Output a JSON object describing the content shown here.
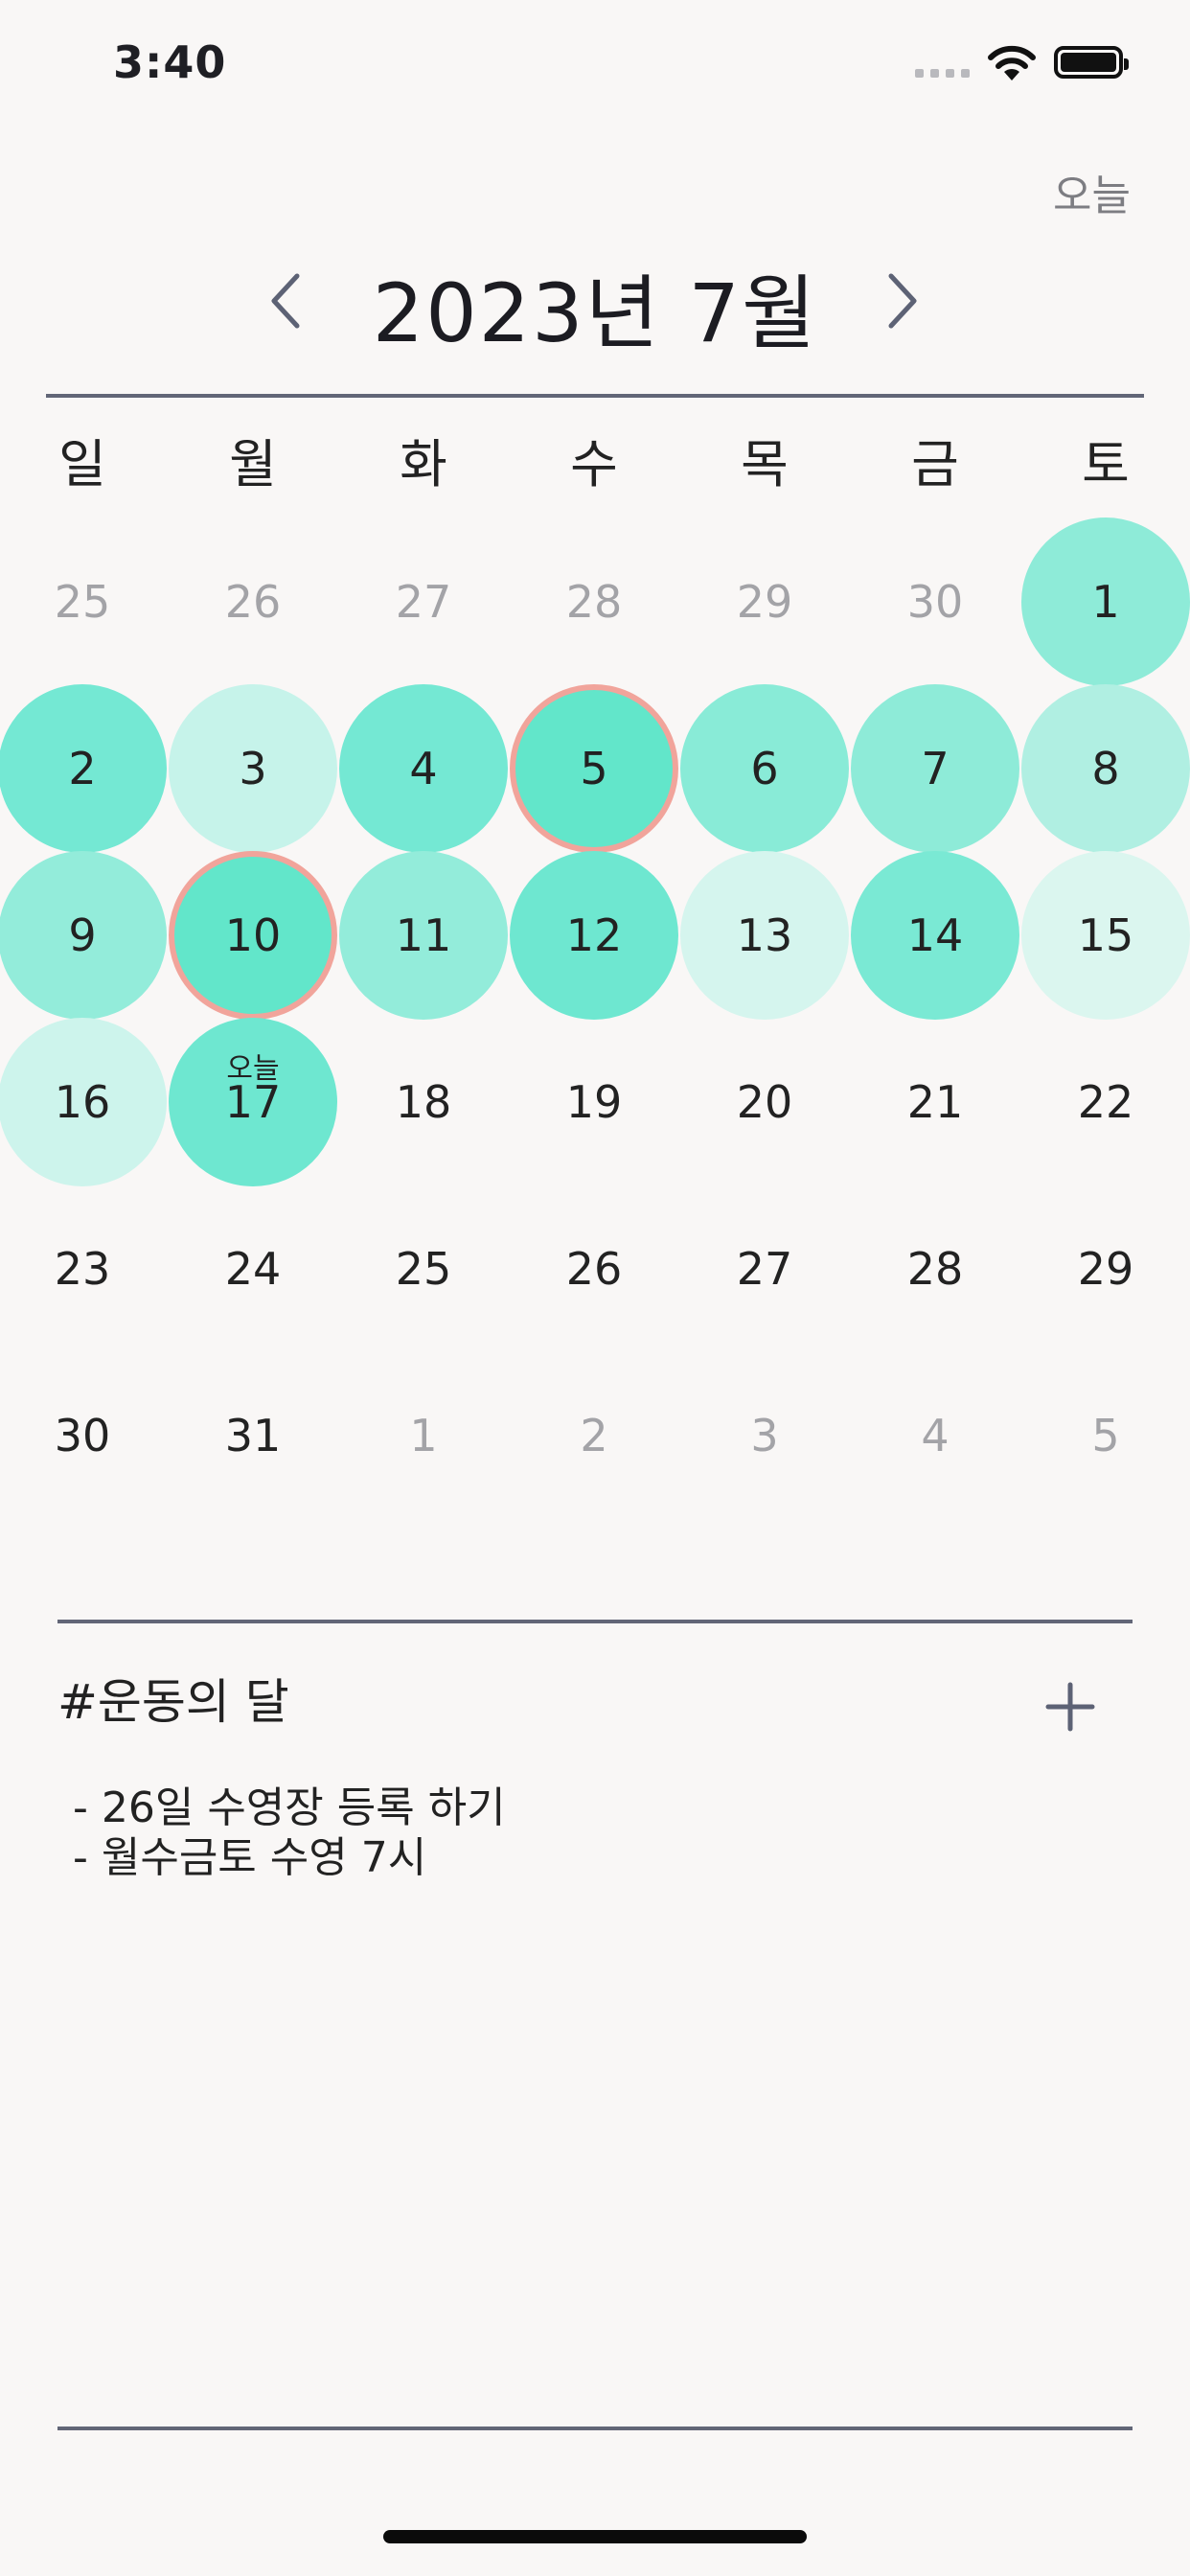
{
  "status_bar": {
    "time": "3:40"
  },
  "header": {
    "today_button": "오늘",
    "month_title": "2023년 7월"
  },
  "weekdays": [
    "일",
    "월",
    "화",
    "수",
    "목",
    "금",
    "토"
  ],
  "calendar": {
    "today_tag": "오늘",
    "weeks": [
      [
        {
          "d": "25",
          "other": true
        },
        {
          "d": "26",
          "other": true
        },
        {
          "d": "27",
          "other": true
        },
        {
          "d": "28",
          "other": true
        },
        {
          "d": "29",
          "other": true
        },
        {
          "d": "30",
          "other": true
        },
        {
          "d": "1",
          "color": "#8eebd8"
        }
      ],
      [
        {
          "d": "2",
          "color": "#74e8d3"
        },
        {
          "d": "3",
          "color": "#c6f3ea"
        },
        {
          "d": "4",
          "color": "#74e8d3"
        },
        {
          "d": "5",
          "color": "#62e6ca",
          "ring": true
        },
        {
          "d": "6",
          "color": "#89ebd7"
        },
        {
          "d": "7",
          "color": "#8eebd8"
        },
        {
          "d": "8",
          "color": "#b0efe2"
        }
      ],
      [
        {
          "d": "9",
          "color": "#93ecda"
        },
        {
          "d": "10",
          "color": "#62e6ca",
          "ring": true
        },
        {
          "d": "11",
          "color": "#93ecda"
        },
        {
          "d": "12",
          "color": "#6ee7d0"
        },
        {
          "d": "13",
          "color": "#d5f5ee"
        },
        {
          "d": "14",
          "color": "#7ae9d4"
        },
        {
          "d": "15",
          "color": "#dbf6ef"
        }
      ],
      [
        {
          "d": "16",
          "color": "#cdf4ec"
        },
        {
          "d": "17",
          "color": "#6ee7d0",
          "today": true
        },
        {
          "d": "18"
        },
        {
          "d": "19"
        },
        {
          "d": "20"
        },
        {
          "d": "21"
        },
        {
          "d": "22"
        }
      ],
      [
        {
          "d": "23"
        },
        {
          "d": "24"
        },
        {
          "d": "25"
        },
        {
          "d": "26"
        },
        {
          "d": "27"
        },
        {
          "d": "28"
        },
        {
          "d": "29"
        }
      ],
      [
        {
          "d": "30"
        },
        {
          "d": "31"
        },
        {
          "d": "1",
          "other": true
        },
        {
          "d": "2",
          "other": true
        },
        {
          "d": "3",
          "other": true
        },
        {
          "d": "4",
          "other": true
        },
        {
          "d": "5",
          "other": true
        }
      ]
    ]
  },
  "memo": {
    "title": "#운동의 달",
    "lines": [
      "- 26일 수영장 등록 하기",
      "- 월수금토 수영 7시"
    ]
  },
  "colors": {
    "rule": "#626677",
    "ring": "#f1a49b",
    "background": "#f9f7f6"
  }
}
